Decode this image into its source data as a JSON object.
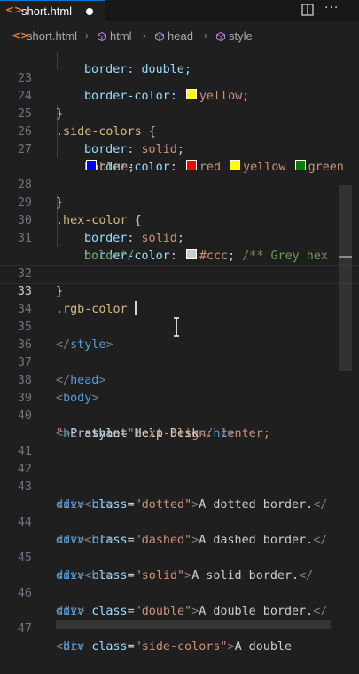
{
  "tab": {
    "title": "short.html",
    "modified": true
  },
  "breadcrumbs": [
    "short.html",
    "html",
    "head",
    "style"
  ],
  "swatch_colors": {
    "yellow": "#ffff00",
    "red": "#ff0000",
    "green": "#008000",
    "blue": "#0000ff",
    "grey": "#cccccc"
  },
  "lines": {
    "n23": "23",
    "n24": "24",
    "n25": "25",
    "n26": "26",
    "n27": "27",
    "n28": "28",
    "n29": "29",
    "n30": "30",
    "n31": "31",
    "n32": "32",
    "n33": "33",
    "n34": "34",
    "n35": "35",
    "n36": "36",
    "n37": "37",
    "n38": "38",
    "n39": "39",
    "n40": "40",
    "n41": "41",
    "n42": "42",
    "n43": "43",
    "n44": "44",
    "n45": "45",
    "n46": "46",
    "n47": "47"
  },
  "code": {
    "partial_top": "border: double;",
    "bc": "border-color",
    "border": "border",
    "solid": "solid",
    "yellow": "yellow",
    "side_colors": ".side-colors",
    "red": "red",
    "green": "green",
    "blue": "blue",
    "hex_color": ".hex-color",
    "ccc": "#ccc",
    "comment1": "/** Grey hex",
    "comment2": "color*/",
    "rgb_color": ".rgb-color",
    "style": "style",
    "head": "head",
    "body": "body",
    "h1": "h1",
    "style_attr": "style",
    "style_val1": "\"text-align: center;",
    "style_val2": "\"",
    "h1_text": "Prashant Help Desk",
    "div": "div",
    "class": "class",
    "br": "br",
    "dotted": "\"dotted\"",
    "dotted_text": "A dotted border.",
    "dashed": "\"dashed\"",
    "dashed_text": "A dashed border.",
    "solid_cls": "\"solid\"",
    "solid_text": "A solid border.",
    "double_cls": "\"double\"",
    "double_text": "A double border.",
    "side_cls": "\"side-colors\"",
    "side_text": "A double"
  }
}
